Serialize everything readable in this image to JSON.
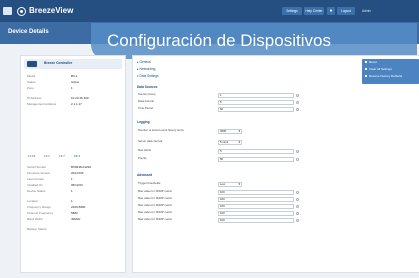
{
  "topbar": {
    "app_name": "BreezeView",
    "btn1": "Settings",
    "btn2": "Help Center",
    "btn3": "Logout",
    "user": "Admin"
  },
  "subbar": {
    "page_title": "Device Details"
  },
  "banner": {
    "text": "Configuración de Dispositivos"
  },
  "left": {
    "device_name": "Breeze Controller",
    "rows": [
      {
        "k": "Model",
        "v": "BV-1"
      },
      {
        "k": "Status",
        "v": "Active"
      },
      {
        "k": "Zone",
        "v": "1"
      },
      {
        "k": "IP Address",
        "v": "10.23.45.100"
      },
      {
        "k": "Management Address",
        "v": "2.1.1.17"
      },
      {
        "k": "Serial Number",
        "v": "BV8238-01220"
      },
      {
        "k": "Firmware Version",
        "v": "2024.006"
      },
      {
        "k": "Last Contact",
        "v": "1"
      },
      {
        "k": "Installed On",
        "v": "05/12/23"
      },
      {
        "k": "Device Status",
        "v": "1"
      },
      {
        "k": "Location",
        "v": "1"
      },
      {
        "k": "Frequency Range",
        "v": "2400-5800"
      },
      {
        "k": "Channel Frequency",
        "v": "5880"
      },
      {
        "k": "Band Width",
        "v": "40MHz"
      },
      {
        "k": "Backup Status",
        "v": ""
      }
    ],
    "chips": [
      "11:15",
      "12:1",
      "13:7",
      "14:1"
    ]
  },
  "form": {
    "accordions": [
      {
        "label": "General",
        "open": false
      },
      {
        "label": "Networking",
        "open": false
      },
      {
        "label": "Data Settings",
        "open": true
      }
    ],
    "section1": "Data Sources",
    "rows1": [
      {
        "label": "Source Group",
        "value": "1"
      },
      {
        "label": "Data Interval",
        "value": "5"
      },
      {
        "label": "Time Period",
        "value": "60"
      }
    ],
    "section2": "Logging",
    "rows2": [
      {
        "label": "Number of stored event history items",
        "value": "3600",
        "type": "input"
      },
      {
        "label": "Server data interval",
        "value": "5 mins",
        "type": "select"
      },
      {
        "label": "Max Alerts",
        "value": "5",
        "type": "input"
      },
      {
        "label": "Priority",
        "value": "60",
        "type": "input"
      }
    ],
    "section3": "Advanced",
    "rows3": [
      {
        "label": "Trigger thresholds",
        "value": "Low",
        "type": "select"
      },
      {
        "label": "Max value for SNMP metric",
        "value": "100",
        "type": "input"
      },
      {
        "label": "Max value for SNMP metric",
        "value": "100",
        "type": "input"
      },
      {
        "label": "Max value for SNMP metric",
        "value": "100",
        "type": "input"
      },
      {
        "label": "Max value for SNMP metric",
        "value": "100",
        "type": "input"
      },
      {
        "label": "Max value for SNMP metric",
        "value": "100",
        "type": "input"
      }
    ]
  },
  "right_menu": {
    "items": [
      "Reset",
      "Clear All Settings",
      "Restore Factory Defaults"
    ]
  },
  "colors": {
    "topbar": "#244f80",
    "subbar": "#3c6ca3",
    "banner": "#568dc7",
    "accent": "#244f80"
  },
  "icons": [
    "menu-icon",
    "logo-icon",
    "bell-icon",
    "input-icon"
  ]
}
